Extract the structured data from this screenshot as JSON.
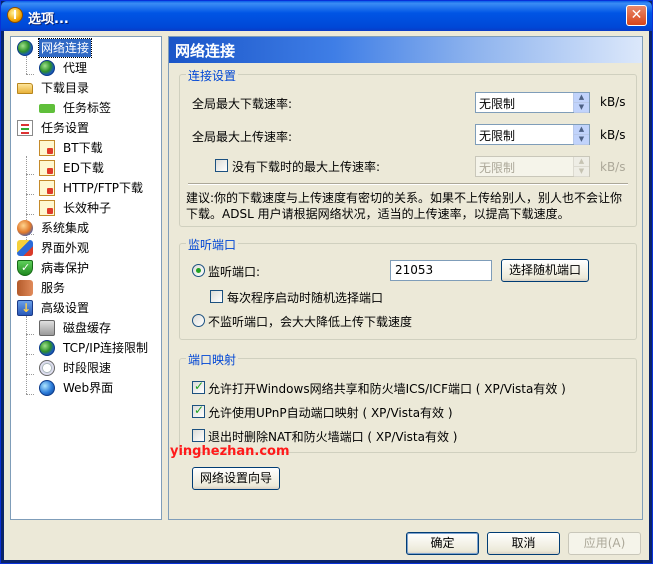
{
  "window": {
    "title": "选项..."
  },
  "tree": [
    {
      "label": "网络连接",
      "icon": "network-globe-icon"
    },
    {
      "label": "代理",
      "icon": "proxy-globe-icon"
    },
    {
      "label": "下载目录",
      "icon": "folder-icon"
    },
    {
      "label": "任务标签",
      "icon": "tag-icon"
    },
    {
      "label": "任务设置",
      "icon": "clipboard-icon"
    },
    {
      "label": "BT下载",
      "icon": "bt-note-icon"
    },
    {
      "label": "ED下载",
      "icon": "ed-note-icon"
    },
    {
      "label": "HTTP/FTP下载",
      "icon": "http-note-icon"
    },
    {
      "label": "长效种子",
      "icon": "seed-note-icon"
    },
    {
      "label": "系统集成",
      "icon": "people-icon"
    },
    {
      "label": "界面外观",
      "icon": "paint-icon"
    },
    {
      "label": "病毒保护",
      "icon": "shield-icon"
    },
    {
      "label": "服务",
      "icon": "service-icon"
    },
    {
      "label": "高级设置",
      "icon": "advanced-gear-icon"
    },
    {
      "label": "磁盘缓存",
      "icon": "disk-icon"
    },
    {
      "label": "TCP/IP连接限制",
      "icon": "tcp-globe-icon"
    },
    {
      "label": "时段限速",
      "icon": "clock-icon"
    },
    {
      "label": "Web界面",
      "icon": "web-globe-icon"
    }
  ],
  "panel": {
    "title": "网络连接"
  },
  "connection": {
    "group_title": "连接设置",
    "max_download_label": "全局最大下载速率:",
    "max_download_value": "无限制",
    "max_upload_label": "全局最大上传速率:",
    "max_upload_value": "无限制",
    "idle_upload_label": "没有下载时的最大上传速率:",
    "idle_upload_value": "无限制",
    "idle_upload_checked": false,
    "unit": "kB/s",
    "advice_line1": "建议:你的下载速度与上传速度有密切的关系。如果不上传给别人，别人也不会让你",
    "advice_line2": "下载。ADSL 用户请根据网络状况，适当的上传速率，以提高下载速度。"
  },
  "listen": {
    "group_title": "监听端口",
    "port_label": "监听端口:",
    "port_value": "21053",
    "random_button": "选择随机端口",
    "random_on_start_label": "每次程序启动时随机选择端口",
    "random_on_start_checked": false,
    "no_listen_label": "不监听端口，会大大降低上传下载速度",
    "selected": "port"
  },
  "mapping": {
    "group_title": "端口映射",
    "ics_label": "允许打开Windows网络共享和防火墙ICS/ICF端口 ( XP/Vista有效 )",
    "ics_checked": true,
    "upnp_label": "允许使用UPnP自动端口映射 ( XP/Vista有效 )",
    "upnp_checked": true,
    "remove_label": "退出时删除NAT和防火墙端口 ( XP/Vista有效 )",
    "remove_checked": false
  },
  "wizard_button": "网络设置向导",
  "footer": {
    "ok": "确定",
    "cancel": "取消",
    "apply": "应用(A)"
  },
  "watermark": "yinghezhan.com"
}
